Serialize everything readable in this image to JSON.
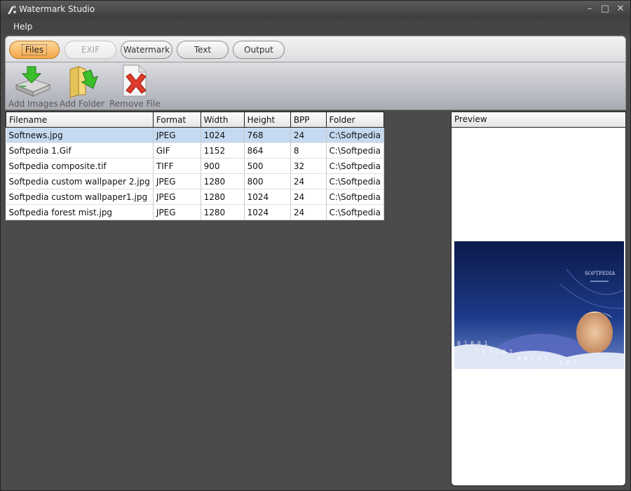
{
  "window": {
    "title": "Watermark Studio"
  },
  "menu": {
    "help": "Help"
  },
  "tabs": [
    {
      "label": "Files",
      "state": "active"
    },
    {
      "label": "EXIF",
      "state": "disabled"
    },
    {
      "label": "Watermark",
      "state": "normal"
    },
    {
      "label": "Text",
      "state": "normal"
    },
    {
      "label": "Output",
      "state": "normal"
    }
  ],
  "toolbar": {
    "add_images": "Add Images",
    "add_folder": "Add Folder",
    "remove_file": "Remove File"
  },
  "table": {
    "headers": [
      "Filename",
      "Format",
      "Width",
      "Height",
      "BPP",
      "Folder"
    ],
    "rows": [
      [
        "Softnews.jpg",
        "JPEG",
        "1024",
        "768",
        "24",
        "C:\\Softpedia"
      ],
      [
        "Softpedia 1.Gif",
        "GIF",
        "1152",
        "864",
        "8",
        "C:\\Softpedia"
      ],
      [
        "Softpedia composite.tif",
        "TIFF",
        "900",
        "500",
        "32",
        "C:\\Softpedia"
      ],
      [
        "Softpedia custom wallpaper 2.jpg",
        "JPEG",
        "1280",
        "800",
        "24",
        "C:\\Softpedia"
      ],
      [
        "Softpedia custom wallpaper1.jpg",
        "JPEG",
        "1280",
        "1024",
        "24",
        "C:\\Softpedia"
      ],
      [
        "Softpedia forest mist.jpg",
        "JPEG",
        "1280",
        "1024",
        "24",
        "C:\\Softpedia"
      ]
    ],
    "selected_row": 0
  },
  "preview": {
    "header": "Preview",
    "image_text": "SOFTPEDIA"
  },
  "colors": {
    "selection": "#c5d9f1",
    "active_tab": "#f3a64a",
    "background": "#4b4b4b"
  }
}
